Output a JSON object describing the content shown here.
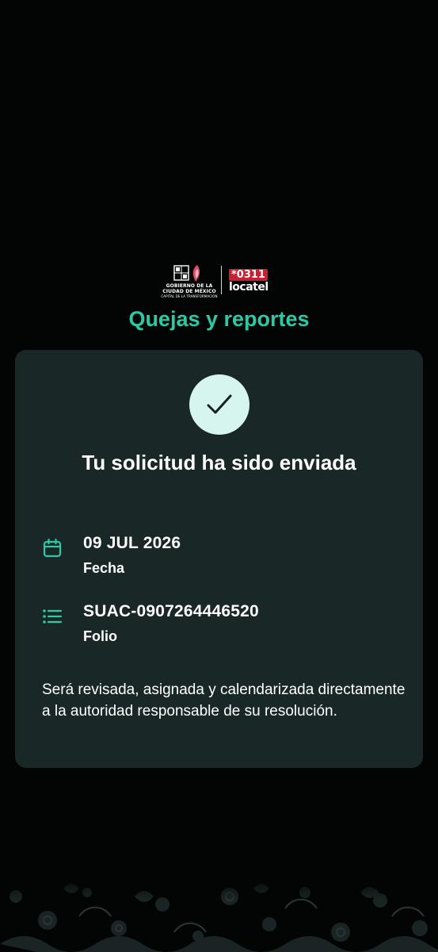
{
  "header": {
    "government_logo": {
      "name": "gobierno-cdmx-logo",
      "line1": "GOBIERNO DE LA",
      "line2": "CIUDAD DE MÉXICO",
      "tagline": "CAPITAL DE LA TRANSFORMACIÓN"
    },
    "locatel_logo": {
      "name": "locatel-logo",
      "number": "*0311",
      "word": "locatel"
    },
    "title": "Quejas y reportes"
  },
  "confirmation": {
    "icon": "checkmark-icon",
    "title": "Tu solicitud ha sido enviada",
    "date": {
      "icon": "calendar-icon",
      "value": "09 JUL 2026",
      "label": "Fecha"
    },
    "folio": {
      "icon": "list-icon",
      "value": "SUAC-0907264446520",
      "label": "Folio"
    },
    "note": "Será revisada, asignada y calendarizada directamente a la autoridad responsable de su resolución."
  },
  "colors": {
    "background": "#030505",
    "accent": "#2dc9a6",
    "card": "#1a2727",
    "check_circle": "#d6f5ee",
    "locatel_red": "#c8202f"
  }
}
